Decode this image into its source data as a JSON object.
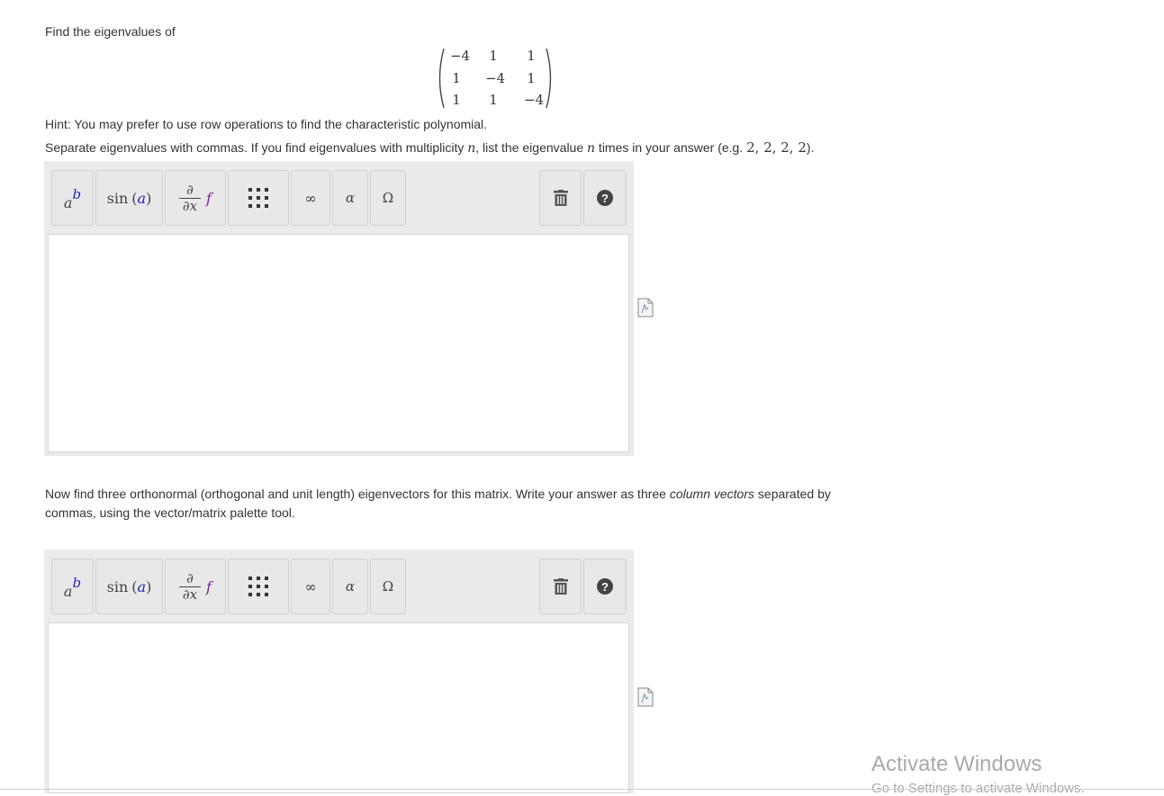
{
  "question": {
    "prompt": "Find the eigenvalues of",
    "matrix": [
      [
        "−4",
        "1",
        "1"
      ],
      [
        "1",
        "−4",
        "1"
      ],
      [
        "1",
        "1",
        "−4"
      ]
    ],
    "hint": "Hint: You may prefer to use row operations to find the characteristic polynomial.",
    "instructions": {
      "part1": "Separate eigenvalues with commas. If you find eigenvalues with multiplicity ",
      "n1": "n",
      "part2": ", list the eigenvalue ",
      "n2": "n",
      "part3": " times in your answer (e.g. ",
      "example": "2, 2, 2, 2",
      "part4": ")."
    },
    "part2_text": {
      "line1_a": "Now find three orthonormal (orthogonal and unit length) eigenvectors for this matrix. Write your answer as three ",
      "line1_em": "column vectors",
      "line1_b": " separated by",
      "line2": "commas, using the vector/matrix palette tool."
    }
  },
  "toolbar": {
    "power_base": "a",
    "power_exp": "b",
    "trig": "sin",
    "trig_arg": "a",
    "deriv_num": "∂",
    "deriv_den": "∂x",
    "deriv_f": "f",
    "infinity": "∞",
    "alpha": "α",
    "omega": "Ω",
    "help": "?"
  },
  "watermark": {
    "title": "Activate Windows",
    "subtitle": "Go to Settings to activate Windows."
  },
  "colors": {
    "palette_bg": "#ebebeb",
    "accent_blue": "#1f1fbf",
    "accent_purple": "#7a1fa2",
    "watermark": "#a9a9a9"
  }
}
